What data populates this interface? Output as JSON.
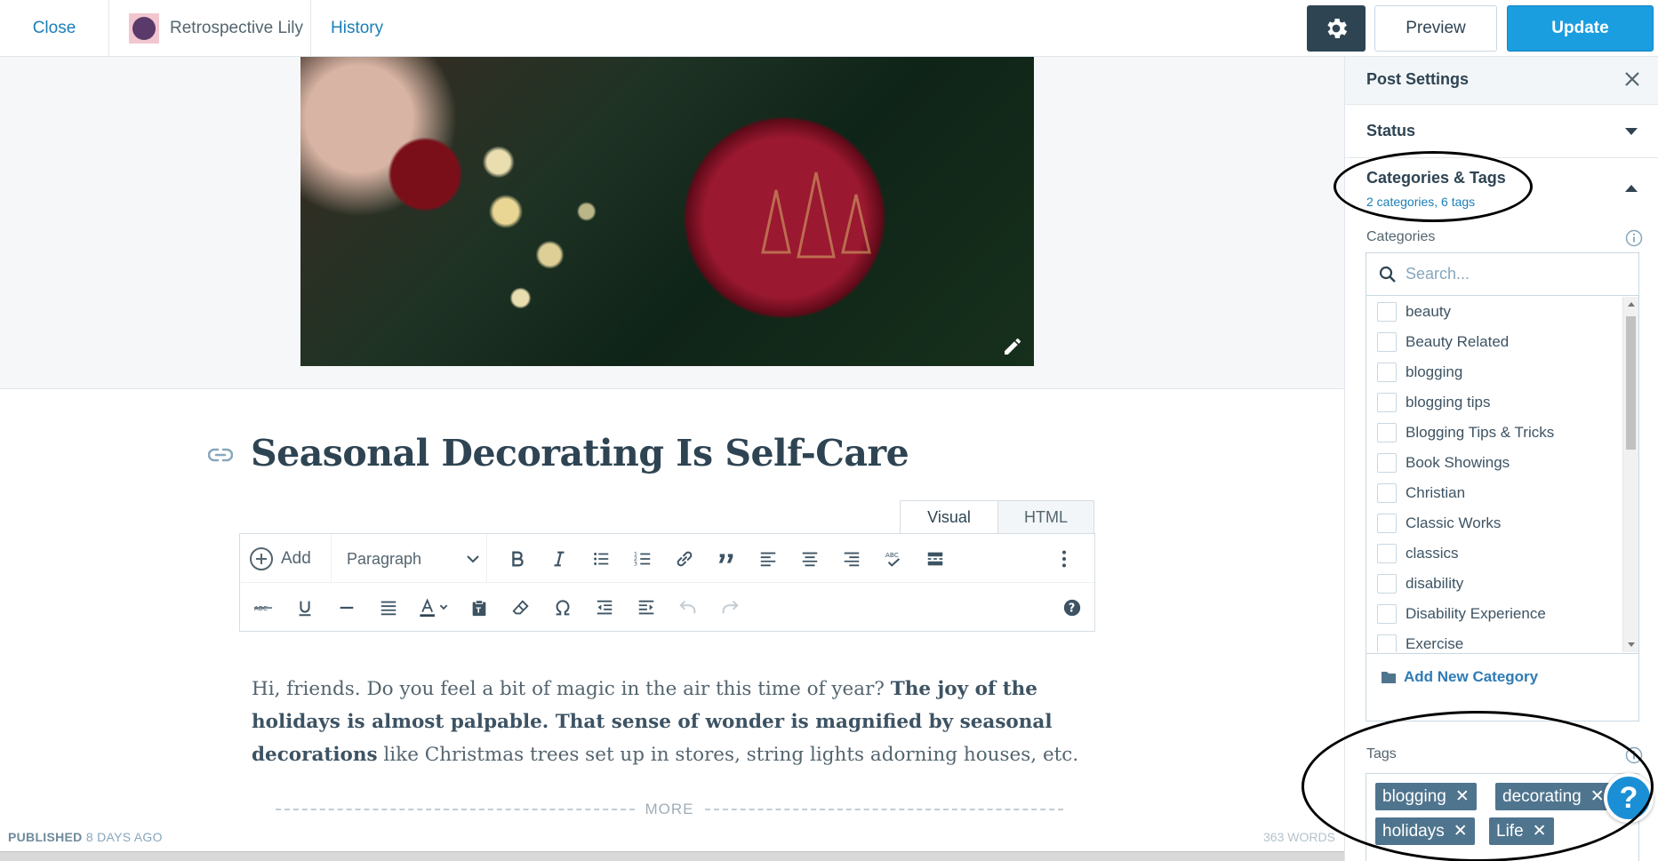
{
  "topbar": {
    "close_label": "Close",
    "site_name": "Retrospective Lily",
    "history_label": "History",
    "preview_label": "Preview",
    "update_label": "Update"
  },
  "post": {
    "title": "Seasonal Decorating Is Self-Care",
    "body_part1": "Hi, friends. Do you feel a bit of magic in the air this time of year? ",
    "body_bold": "The joy of the holidays is almost palpable. That sense of wonder is magnified by seasonal decorations",
    "body_part2": " like Christmas trees set up in stores, string lights adorning houses, etc.",
    "more_label": "MORE"
  },
  "editor": {
    "tabs": [
      "Visual",
      "HTML"
    ],
    "add_label": "Add",
    "format_select": "Paragraph",
    "toolbar_row1_icons": [
      "bold-icon",
      "italic-icon",
      "bullet-list-icon",
      "numbered-list-icon",
      "link-icon",
      "blockquote-icon",
      "align-left-icon",
      "align-center-icon",
      "align-right-icon",
      "spellcheck-icon",
      "read-more-icon",
      "more-options-icon"
    ],
    "toolbar_row2_icons": [
      "strikethrough-icon",
      "underline-icon",
      "horizontal-line-icon",
      "justify-icon",
      "text-color-icon",
      "paste-text-icon",
      "clear-formatting-icon",
      "special-character-icon",
      "outdent-icon",
      "indent-icon",
      "undo-icon",
      "redo-icon",
      "help-icon"
    ]
  },
  "status_bar": {
    "published_label": "PUBLISHED",
    "published_time": "8 DAYS AGO",
    "word_count": "363 WORDS"
  },
  "sidebar": {
    "title": "Post Settings",
    "status_label": "Status",
    "cat_tags_label": "Categories & Tags",
    "cat_tags_summary": "2 categories, 6 tags",
    "categories_label": "Categories",
    "search_placeholder": "Search...",
    "categories": [
      "beauty",
      "Beauty Related",
      "blogging",
      "blogging tips",
      "Blogging Tips & Tricks",
      "Book Showings",
      "Christian",
      "Classic Works",
      "classics",
      "disability",
      "Disability Experience",
      "Exercise"
    ],
    "add_category_label": "Add New Category",
    "tags_label": "Tags",
    "tags": [
      "blogging",
      "decorating",
      "holidays",
      "Life"
    ]
  },
  "colors": {
    "accent": "#1b9ee0",
    "dark": "#2e4453",
    "tag": "#4f748e"
  }
}
